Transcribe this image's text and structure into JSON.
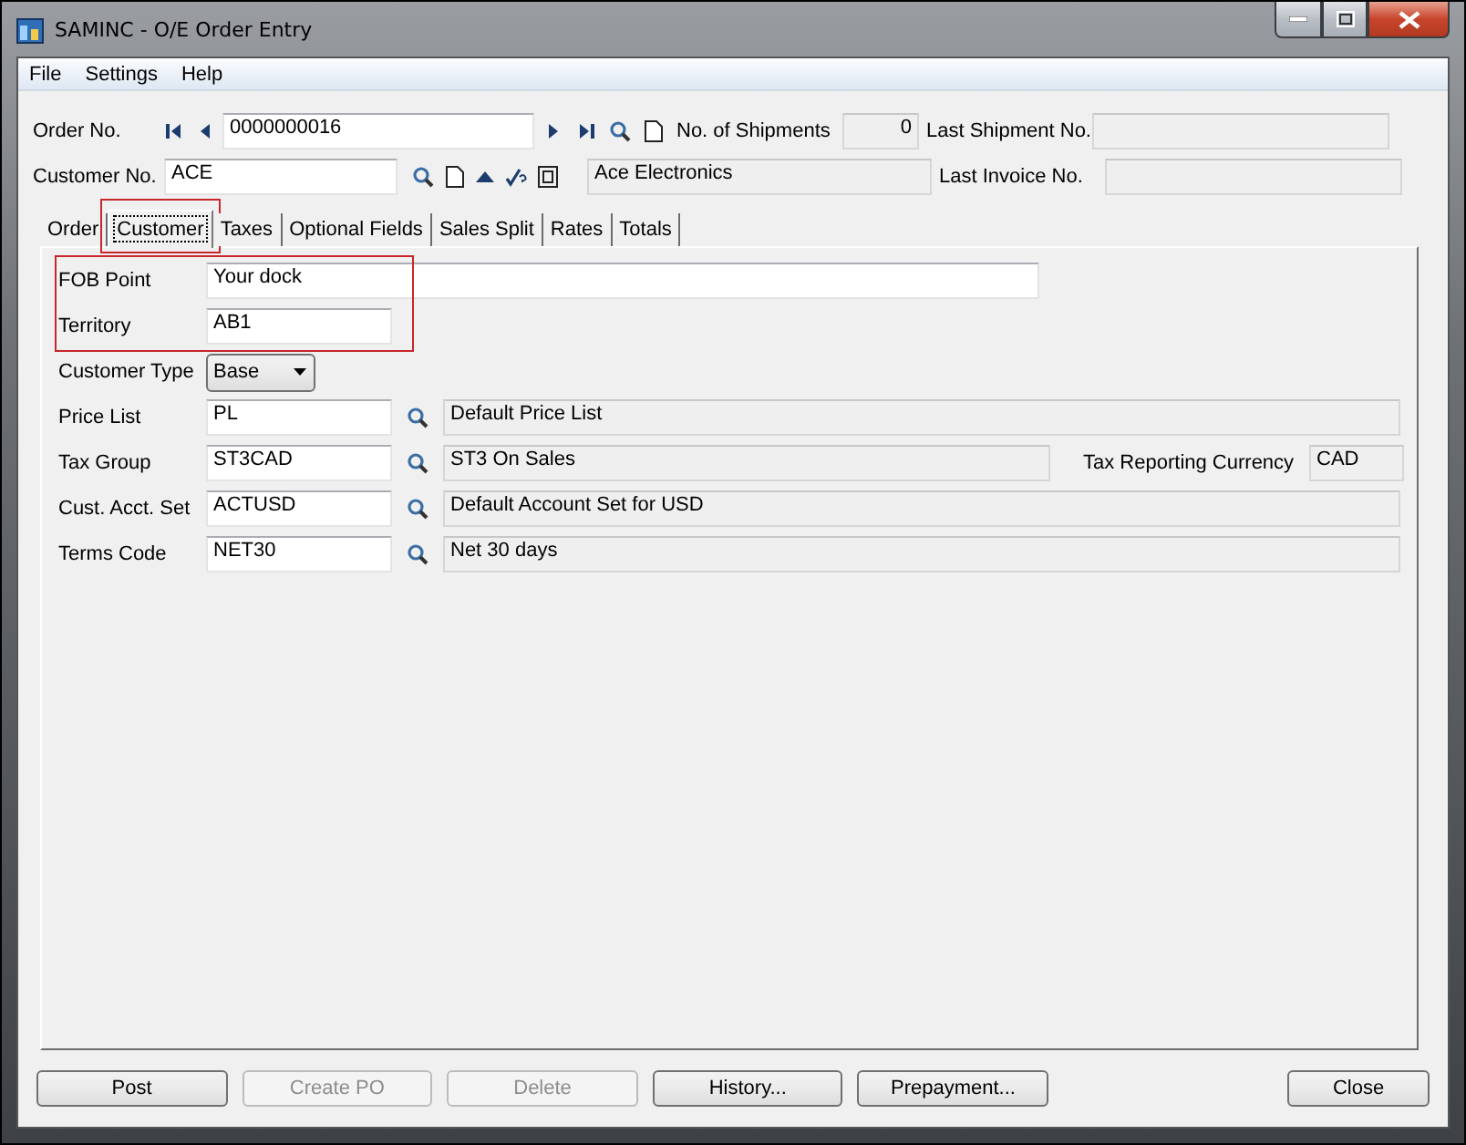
{
  "window": {
    "title": "SAMINC - O/E Order Entry"
  },
  "menu": [
    "File",
    "Settings",
    "Help"
  ],
  "header": {
    "order_no": {
      "label": "Order No.",
      "value": "0000000016"
    },
    "shipments": {
      "label": "No. of Shipments",
      "value": "0"
    },
    "last_shipment": {
      "label": "Last Shipment No."
    },
    "customer_no": {
      "label": "Customer No.",
      "value": "ACE"
    },
    "customer_name": "Ace Electronics",
    "last_invoice": {
      "label": "Last Invoice No."
    }
  },
  "tabs": [
    {
      "label": "Order",
      "selected": false,
      "highlighted": false
    },
    {
      "label": "Customer",
      "selected": true,
      "highlighted": true
    },
    {
      "label": "Taxes",
      "selected": false,
      "highlighted": false
    },
    {
      "label": "Optional Fields",
      "selected": false,
      "highlighted": false
    },
    {
      "label": "Sales Split",
      "selected": false,
      "highlighted": false
    },
    {
      "label": "Rates",
      "selected": false,
      "highlighted": false
    },
    {
      "label": "Totals",
      "selected": false,
      "highlighted": false
    }
  ],
  "rows": [
    {
      "kind": "wide",
      "label": "FOB Point",
      "value": "Your dock",
      "highlighted": true
    },
    {
      "kind": "short",
      "label": "Territory",
      "value": "AB1",
      "highlighted": true
    },
    {
      "kind": "dropdown",
      "label": "Customer Type",
      "value": "Base",
      "highlighted": false
    },
    {
      "kind": "lookup",
      "label": "Price List",
      "value": "PL",
      "description": "Default Price List",
      "highlighted": false
    },
    {
      "kind": "lookup",
      "label": "Tax Group",
      "value": "ST3CAD",
      "description": "ST3 On Sales",
      "extra_label": "Tax Reporting Currency",
      "extra_value": "CAD",
      "highlighted": false
    },
    {
      "kind": "lookup",
      "label": "Cust. Acct. Set",
      "value": "ACTUSD",
      "description": "Default Account Set for USD",
      "highlighted": false
    },
    {
      "kind": "lookup",
      "label": "Terms Code",
      "value": "NET30",
      "description": "Net 30 days",
      "highlighted": false
    }
  ],
  "buttons": [
    {
      "label": "Post",
      "disabled": false
    },
    {
      "label": "Create PO",
      "disabled": true
    },
    {
      "label": "Delete",
      "disabled": true
    },
    {
      "label": "History...",
      "disabled": false
    },
    {
      "label": "Prepayment...",
      "disabled": false
    },
    {
      "label": "Close",
      "disabled": false
    }
  ]
}
